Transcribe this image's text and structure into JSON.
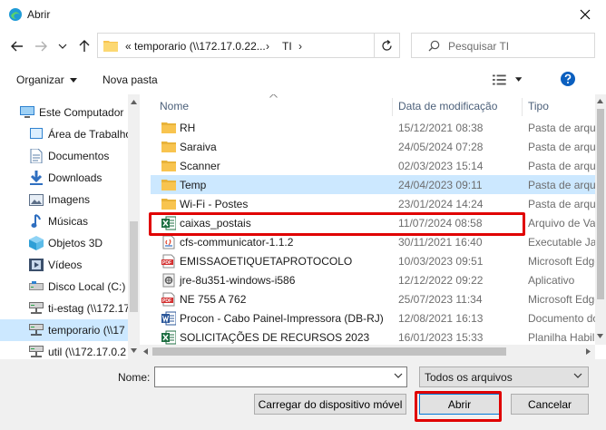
{
  "window": {
    "title": "Abrir"
  },
  "address": {
    "parts": [
      "«",
      "temporario (\\\\172.17.0.22...",
      "›",
      "TI",
      "›"
    ]
  },
  "search": {
    "placeholder": "Pesquisar TI"
  },
  "toolbar": {
    "organize": "Organizar",
    "new_folder": "Nova pasta"
  },
  "sidebar": {
    "items": [
      {
        "label": "Este Computador",
        "icon": "computer-icon"
      },
      {
        "label": "Área de Trabalho",
        "icon": "desktop-icon"
      },
      {
        "label": "Documentos",
        "icon": "documents-icon"
      },
      {
        "label": "Downloads",
        "icon": "downloads-icon"
      },
      {
        "label": "Imagens",
        "icon": "pictures-icon"
      },
      {
        "label": "Músicas",
        "icon": "music-icon"
      },
      {
        "label": "Objetos 3D",
        "icon": "3d-objects-icon"
      },
      {
        "label": "Vídeos",
        "icon": "videos-icon"
      },
      {
        "label": "Disco Local (C:)",
        "icon": "drive-icon"
      },
      {
        "label": "ti-estag (\\\\172.17",
        "icon": "network-drive-icon"
      },
      {
        "label": "temporario (\\\\17",
        "icon": "network-drive-icon"
      },
      {
        "label": "util (\\\\172.17.0.2",
        "icon": "network-drive-icon"
      }
    ]
  },
  "columns": {
    "name": "Nome",
    "date": "Data de modificação",
    "type": "Tipo"
  },
  "files": [
    {
      "name": "RH",
      "date": "15/12/2021 08:38",
      "type": "Pasta de arquivos",
      "icon": "folder-icon"
    },
    {
      "name": "Saraiva",
      "date": "24/05/2024 07:28",
      "type": "Pasta de arquivos",
      "icon": "folder-icon"
    },
    {
      "name": "Scanner",
      "date": "02/03/2023 15:14",
      "type": "Pasta de arquivos",
      "icon": "folder-icon"
    },
    {
      "name": "Temp",
      "date": "24/04/2023 09:11",
      "type": "Pasta de arquivos",
      "icon": "folder-icon"
    },
    {
      "name": "Wi-Fi - Postes",
      "date": "23/01/2024 14:24",
      "type": "Pasta de arquivos",
      "icon": "folder-icon"
    },
    {
      "name": "caixas_postais",
      "date": "11/07/2024 08:58",
      "type": "Arquivo de Valores",
      "icon": "excel-icon"
    },
    {
      "name": "cfs-communicator-1.1.2",
      "date": "30/11/2021 16:40",
      "type": "Executable Jar",
      "icon": "jar-icon"
    },
    {
      "name": "EMISSAOETIQUETAPROTOCOLO",
      "date": "10/03/2023 09:51",
      "type": "Microsoft Edge",
      "icon": "pdf-icon"
    },
    {
      "name": "jre-8u351-windows-i586",
      "date": "12/12/2022 09:22",
      "type": "Aplicativo",
      "icon": "installer-icon"
    },
    {
      "name": "NE 755 A 762",
      "date": "25/07/2023 11:34",
      "type": "Microsoft Edge",
      "icon": "pdf-icon"
    },
    {
      "name": "Procon - Cabo Painel-Impressora (DB-RJ)",
      "date": "12/08/2021 16:13",
      "type": "Documento do",
      "icon": "word-icon"
    },
    {
      "name": "SOLICITAÇÕES DE RECURSOS 2023",
      "date": "16/01/2023 15:33",
      "type": "Planilha Habilitada",
      "icon": "excel-icon"
    }
  ],
  "bottom": {
    "name_label": "Nome:",
    "name_value": "",
    "filter": "Todos os arquivos",
    "upload_button": "Carregar do dispositivo móvel",
    "open_button": "Abrir",
    "cancel_button": "Cancelar"
  },
  "colors": {
    "selection": "#cce8ff",
    "highlight": "#e00000",
    "accent": "#0078d7",
    "folder": "#f8c44f"
  }
}
